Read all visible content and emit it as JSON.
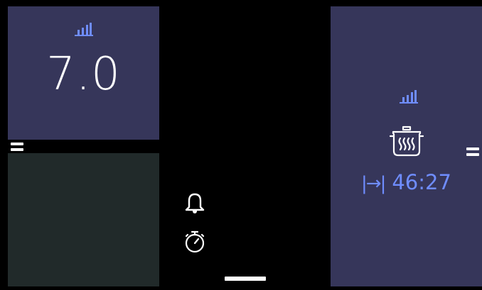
{
  "zones": {
    "top_left": {
      "power_level": "7.0",
      "power_icon": "power-level-icon"
    },
    "bottom_left": {
      "status": "empty"
    },
    "right": {
      "power_icon": "power-level-icon",
      "program_icon": "pot-steam-icon",
      "timer_arrow": "|→|",
      "timer_value": "46:27"
    }
  },
  "controls": {
    "bell_icon": "bell-icon",
    "stopwatch_icon": "stopwatch-icon",
    "grip_icon": "grip-icon"
  },
  "colors": {
    "zone_active": "#36365a",
    "zone_inactive": "#212a2a",
    "accent": "#6f8dff",
    "text": "#ffffff",
    "background": "#000000"
  }
}
